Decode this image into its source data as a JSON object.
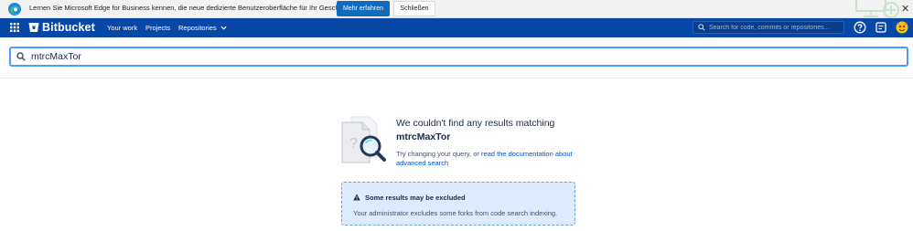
{
  "infobar": {
    "message": "Lernen Sie Microsoft Edge for Business kennen, die neue dedizierte Benutzeroberfläche für Ihr Geschäftskonto.",
    "learn_more": "Mehr erfahren",
    "close": "Schließen",
    "dismiss_glyph": "✕",
    "icon": "edge-icon"
  },
  "nav": {
    "app_switcher_icon": "grid-icon",
    "logo_text": "Bitbucket",
    "items": [
      {
        "label": "Your work"
      },
      {
        "label": "Projects"
      },
      {
        "label": "Repositories"
      }
    ],
    "search_placeholder": "Search for code, commits or repositories...",
    "icons": [
      "help-icon",
      "notes-icon",
      "user-avatar"
    ],
    "colors": {
      "bar": "#0747a6",
      "accent": "#4c9aff"
    }
  },
  "search": {
    "query": "mtrcMaxTor"
  },
  "empty_state": {
    "title": "We couldn't find any results matching",
    "query": "mtrcMaxTor",
    "help_prefix": "Try changing your query, or ",
    "help_link": "read the documentation about advanced search"
  },
  "notice": {
    "title": "Some results may be excluded",
    "body": "Your administrator excludes some forks from code search indexing.",
    "icon": "warning-icon"
  }
}
